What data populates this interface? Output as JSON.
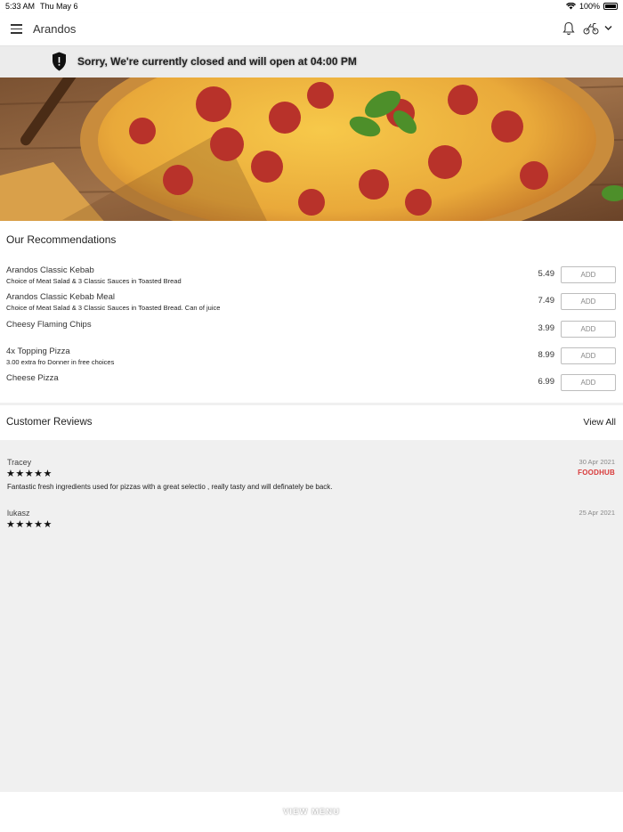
{
  "status_bar": {
    "time": "5:33 AM",
    "date": "Thu May 6",
    "battery": "100%"
  },
  "header": {
    "title": "Arandos",
    "icons": [
      "menu-icon",
      "bell-icon",
      "bike-icon",
      "chevron-down-icon"
    ]
  },
  "banner": {
    "message": "Sorry, We're currently closed and will open at 04:00 PM",
    "icon": "shield-alert-icon"
  },
  "hero": {
    "image": "pepperoni-pizza-photo"
  },
  "recommendations": {
    "title": "Our Recommendations",
    "add_label": "ADD",
    "items": [
      {
        "name": "Arandos Classic Kebab",
        "desc": "Choice of Meat Salad & 3 Classic Sauces in Toasted Bread",
        "price": "5.49"
      },
      {
        "name": "Arandos Classic Kebab Meal",
        "desc": "Choice of Meat Salad & 3 Classic Sauces in Toasted Bread. Can of juice",
        "price": "7.49"
      },
      {
        "name": "Cheesy Flaming Chips",
        "desc": "",
        "price": "3.99"
      },
      {
        "name": "4x Topping Pizza",
        "desc": "3.00 extra fro Donner in free choices",
        "price": "8.99"
      },
      {
        "name": "Cheese Pizza",
        "desc": "",
        "price": "6.99"
      }
    ]
  },
  "reviews": {
    "title": "Customer Reviews",
    "view_all": "View All",
    "items": [
      {
        "name": "Tracey",
        "date": "30 Apr 2021",
        "rating": 5,
        "stars": "★★★★★",
        "text": "Fantastic fresh ingredients used for pizzas with a great selectio , really tasty and will definately be back.",
        "source": "FOODHUB"
      },
      {
        "name": "lukasz",
        "date": "25 Apr 2021",
        "rating": 5,
        "stars": "★★★★★",
        "text": "",
        "source": ""
      }
    ]
  },
  "footer": {
    "button_label": "VIEW MENU"
  },
  "colors": {
    "brand_red": "#d83a3a",
    "banner_bg": "#ececec",
    "page_bg": "#f0f0f0"
  }
}
